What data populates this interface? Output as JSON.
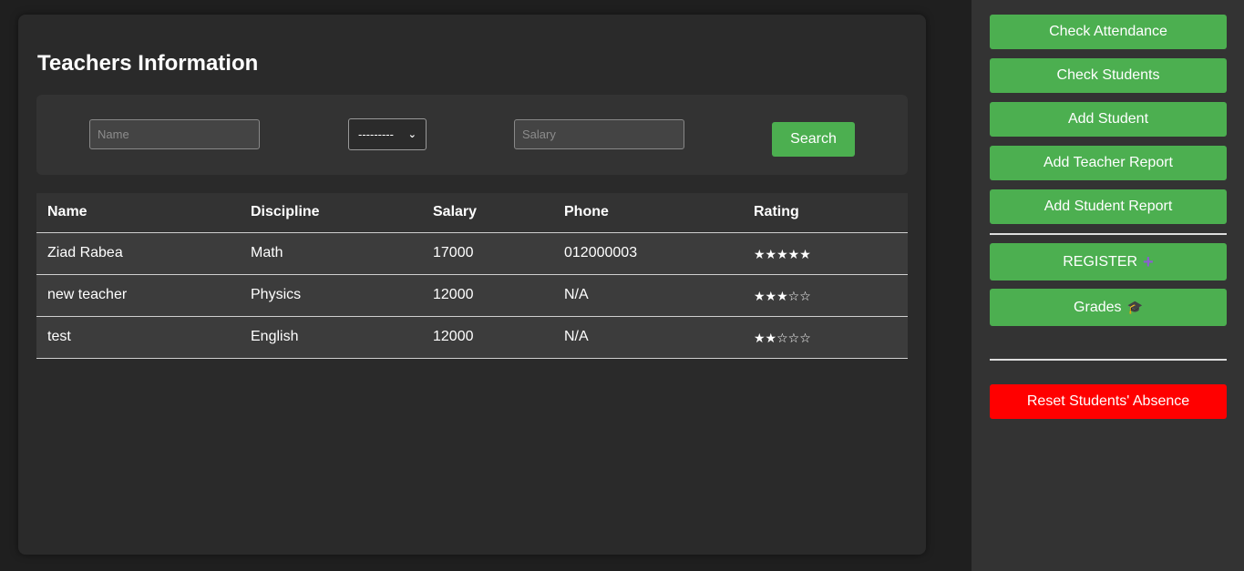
{
  "main": {
    "title": "Teachers Information",
    "search": {
      "name_placeholder": "Name",
      "discipline_selected": "---------",
      "salary_placeholder": "Salary",
      "search_label": "Search"
    },
    "table": {
      "headers": [
        "Name",
        "Discipline",
        "Salary",
        "Phone",
        "Rating"
      ],
      "rows": [
        {
          "name": "Ziad Rabea",
          "discipline": "Math",
          "salary": "17000",
          "phone": "012000003",
          "rating": "★★★★★"
        },
        {
          "name": "new teacher",
          "discipline": "Physics",
          "salary": "12000",
          "phone": "N/A",
          "rating": "★★★☆☆"
        },
        {
          "name": "test",
          "discipline": "English",
          "salary": "12000",
          "phone": "N/A",
          "rating": "★★☆☆☆"
        }
      ]
    }
  },
  "sidebar": {
    "buttons": [
      {
        "label": "Check Attendance"
      },
      {
        "label": "Check Students"
      },
      {
        "label": "Add Student"
      },
      {
        "label": "Add Teacher Report"
      },
      {
        "label": "Add Student Report"
      }
    ],
    "register_label": "REGISTER",
    "register_icon": "plus-icon",
    "grades_label": "Grades",
    "grades_icon": "graduation-cap-icon",
    "reset_label": "Reset Students' Absence"
  },
  "colors": {
    "accent": "#4caf50",
    "danger": "#ff0000",
    "background": "#1f1f1f",
    "panel": "#2a2a2a",
    "sidebar": "#333333"
  }
}
